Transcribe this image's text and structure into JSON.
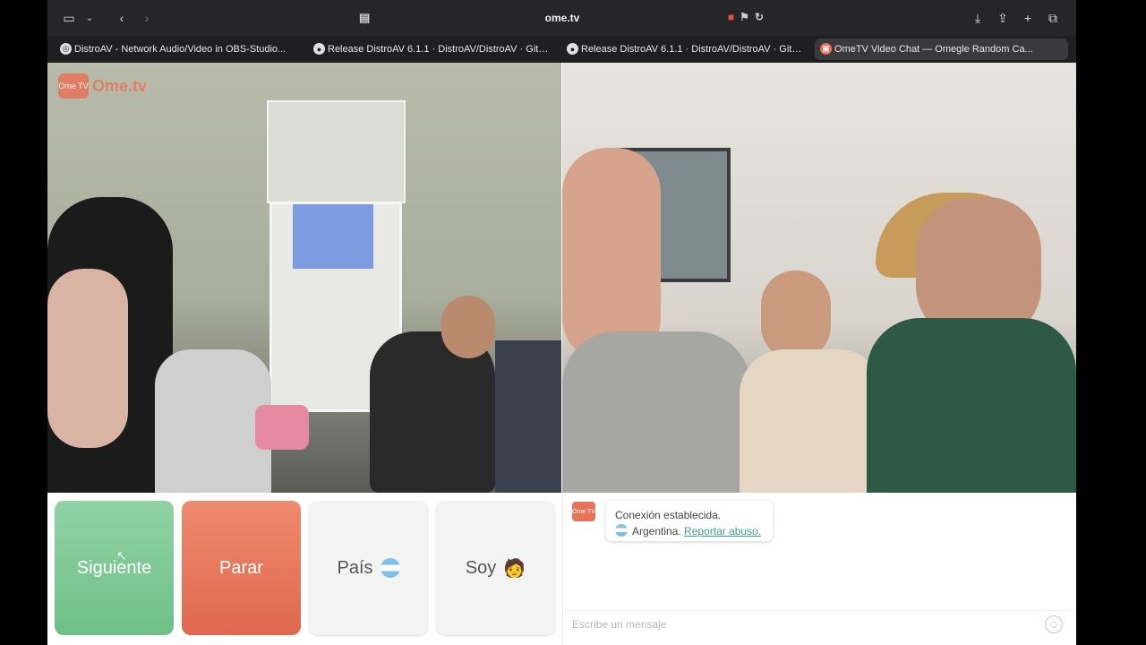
{
  "browser": {
    "url": "ome.tv",
    "tabs": [
      {
        "label": "DistroAV - Network Audio/Video in OBS-Studio...",
        "icon": "globe-icon",
        "active": false
      },
      {
        "label": "Release DistroAV 6.1.1 · DistroAV/DistroAV · GitH...",
        "icon": "github-icon",
        "active": false
      },
      {
        "label": "Release DistroAV 6.1.1 · DistroAV/DistroAV · GitH...",
        "icon": "github-icon",
        "active": false
      },
      {
        "label": "OmeTV Video Chat — Omegle Random Ca...",
        "icon": "ometv-icon",
        "active": true
      }
    ]
  },
  "logo": {
    "badge": "Ome TV",
    "text": "Ome.tv"
  },
  "controls": {
    "next_label": "Siguiente",
    "stop_label": "Parar",
    "country_label": "País",
    "me_label": "Soy",
    "me_emoji": "🧑"
  },
  "chat": {
    "avatar": "Ome TV",
    "status": "Conexión establecida.",
    "country": "Argentina.",
    "report_link": "Reportar abuso.",
    "input_placeholder": "Escribe un mensaje"
  },
  "colors": {
    "next": "#7cc796",
    "stop": "#e57559",
    "brand": "#e8735a",
    "link": "#3aa08f"
  }
}
